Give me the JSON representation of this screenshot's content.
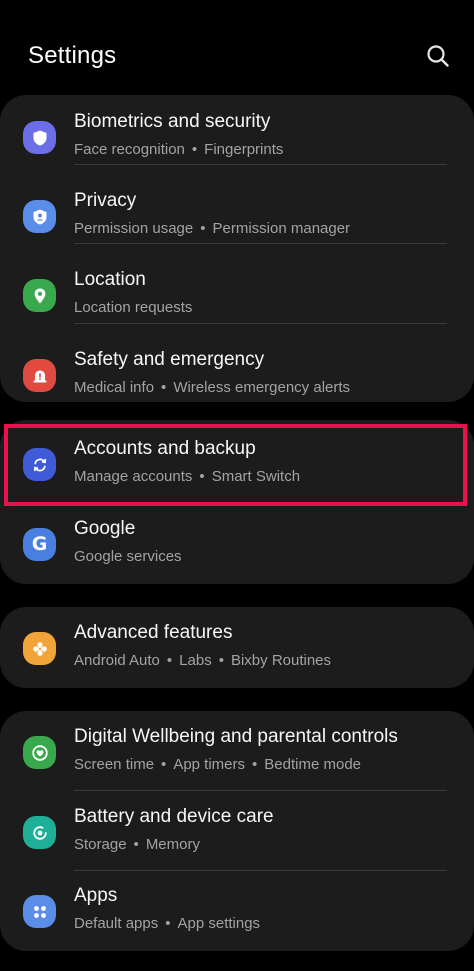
{
  "header": {
    "title": "Settings",
    "search_icon": "search-icon"
  },
  "colors": {
    "highlight": "#e8124e",
    "card": "#1c1c1c"
  },
  "items": [
    {
      "id": "biometrics",
      "label": "Biometrics and security",
      "subs": [
        "Face recognition",
        "Fingerprints"
      ],
      "icon": "shield-icon",
      "color": "#6b6ee6"
    },
    {
      "id": "privacy",
      "label": "Privacy",
      "subs": [
        "Permission usage",
        "Permission manager"
      ],
      "icon": "privacy-shield-icon",
      "color": "#5b8ce8"
    },
    {
      "id": "location",
      "label": "Location",
      "subs": [
        "Location requests"
      ],
      "icon": "location-pin-icon",
      "color": "#3aa84c"
    },
    {
      "id": "safety",
      "label": "Safety and emergency",
      "subs": [
        "Medical info",
        "Wireless emergency alerts"
      ],
      "icon": "alert-icon",
      "color": "#e04a3f"
    },
    {
      "id": "accounts",
      "label": "Accounts and backup",
      "subs": [
        "Manage accounts",
        "Smart Switch"
      ],
      "icon": "sync-icon",
      "color": "#3f5bd8"
    },
    {
      "id": "google",
      "label": "Google",
      "subs": [
        "Google services"
      ],
      "icon": "google-icon",
      "color": "#4a7fe2"
    },
    {
      "id": "advanced",
      "label": "Advanced features",
      "subs": [
        "Android Auto",
        "Labs",
        "Bixby Routines"
      ],
      "icon": "puzzle-icon",
      "color": "#f0a43a"
    },
    {
      "id": "wellbeing",
      "label": "Digital Wellbeing and parental controls",
      "subs": [
        "Screen time",
        "App timers",
        "Bedtime mode"
      ],
      "icon": "wellbeing-heart-icon",
      "color": "#3aa84c"
    },
    {
      "id": "battery",
      "label": "Battery and device care",
      "subs": [
        "Storage",
        "Memory"
      ],
      "icon": "device-care-icon",
      "color": "#1fae97"
    },
    {
      "id": "apps",
      "label": "Apps",
      "subs": [
        "Default apps",
        "App settings"
      ],
      "icon": "apps-grid-icon",
      "color": "#5b8ce8"
    }
  ]
}
